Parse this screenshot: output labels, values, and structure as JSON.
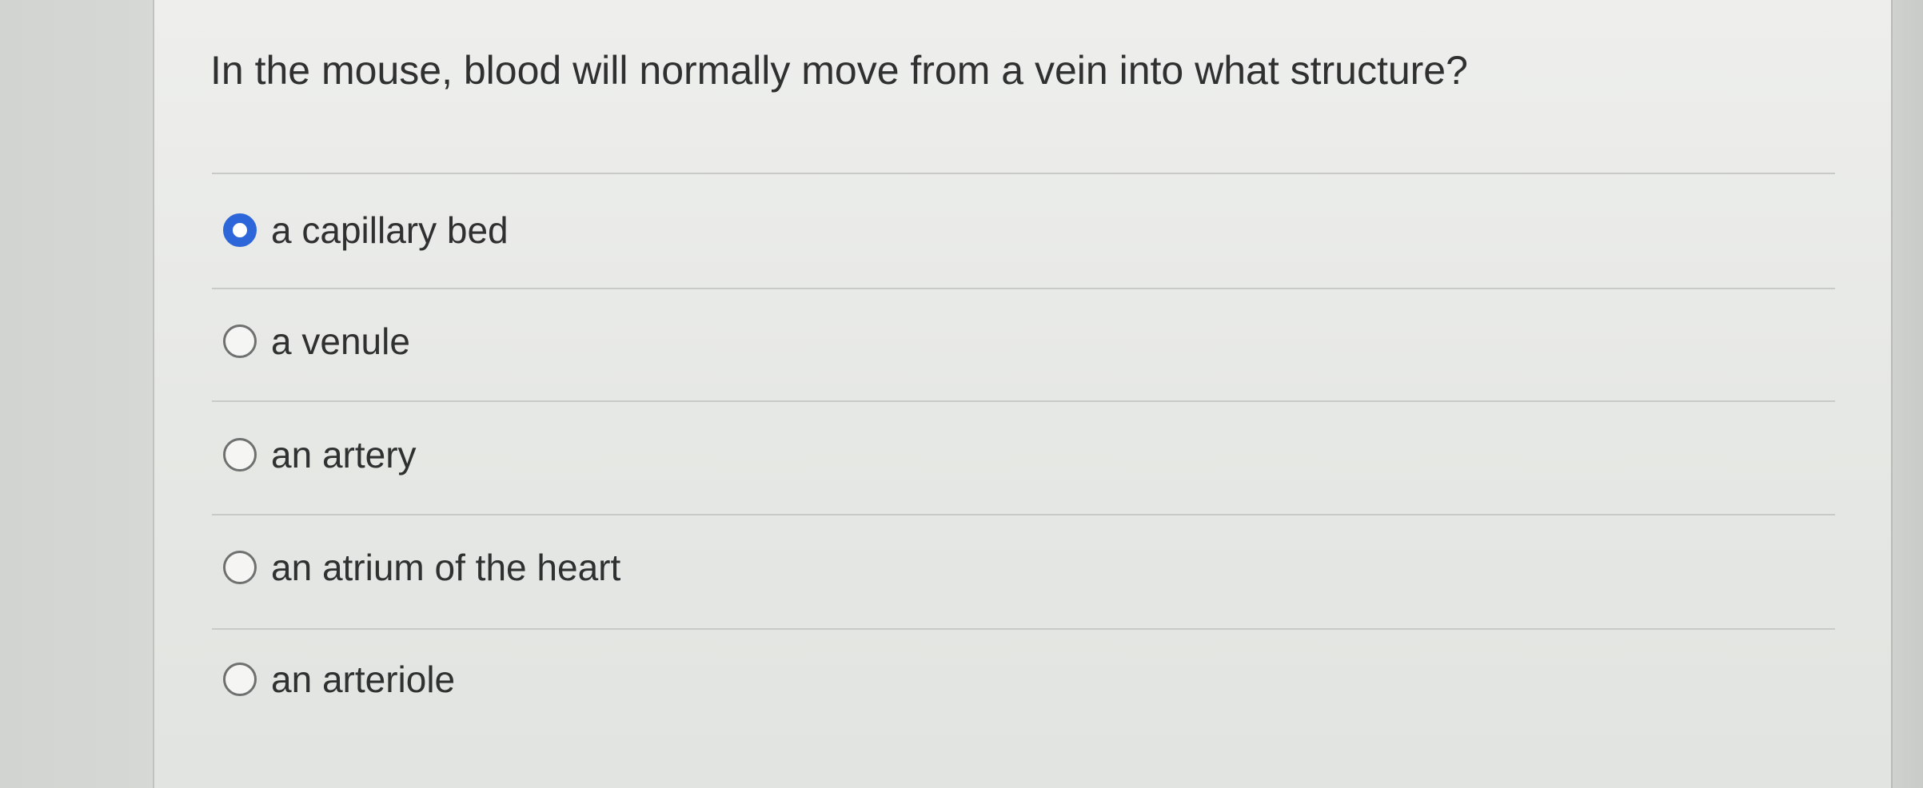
{
  "question": {
    "text": "In the mouse, blood will normally move from a vein into what structure?"
  },
  "choices": [
    {
      "label": "a capillary bed",
      "selected": true
    },
    {
      "label": "a venule",
      "selected": false
    },
    {
      "label": "an artery",
      "selected": false
    },
    {
      "label": "an atrium of the heart",
      "selected": false
    },
    {
      "label": "an arteriole",
      "selected": false
    }
  ],
  "colors": {
    "selected_accent": "#2c66d8",
    "text": "#2f3030",
    "background": "#e6e8e5"
  }
}
